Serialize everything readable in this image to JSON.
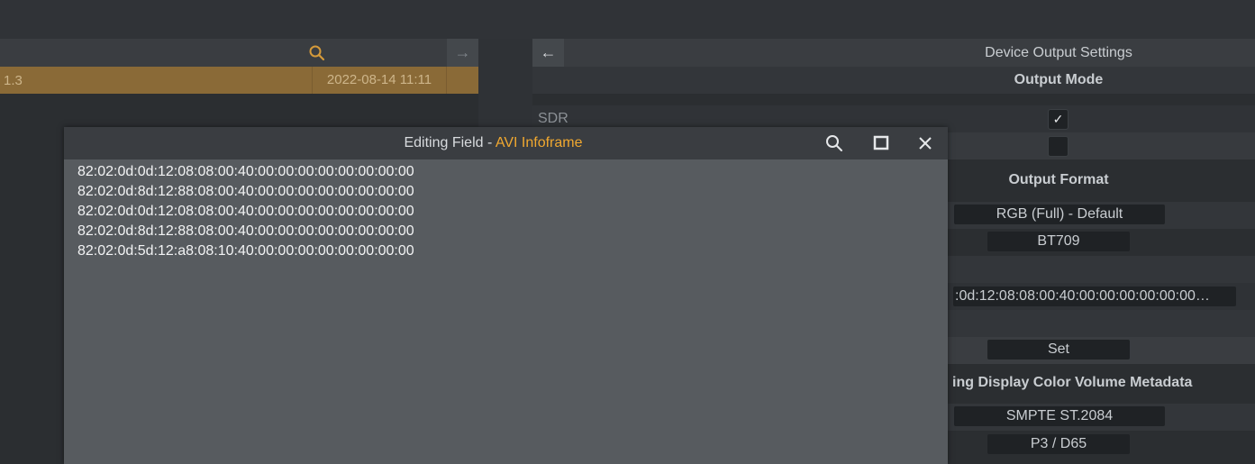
{
  "left_panel": {
    "row": {
      "col1": "1.3",
      "date": "2022-08-14 11:11"
    },
    "arrow_glyph": "→",
    "search_icon": "search-icon"
  },
  "right_panel": {
    "back_glyph": "←",
    "title": "Device Output Settings",
    "output_mode_head": "Output Mode",
    "sdr_label": "SDR",
    "sdr_checked_glyph": "✓",
    "output_format_head": "Output Format",
    "format_value": "RGB (Full) - Default",
    "colorspace_value": "BT709",
    "infoframe_value": ":0d:12:08:08:00:40:00:00:00:00:00:00…",
    "set_label": "Set",
    "mastering_head": "ing Display Color Volume Metadata",
    "eotf_value": "SMPTE ST.2084",
    "primaries_value": "P3 / D65"
  },
  "dialog": {
    "title_prefix": "Editing Field - ",
    "title_accent": "AVI Infoframe",
    "accent_color": "#f0a830",
    "icons": [
      "search-icon",
      "maximize-icon",
      "close-icon"
    ],
    "lines": [
      "82:02:0d:0d:12:08:08:00:40:00:00:00:00:00:00:00:00",
      "82:02:0d:8d:12:88:08:00:40:00:00:00:00:00:00:00:00",
      "82:02:0d:0d:12:08:08:00:40:00:00:00:00:00:00:00:00",
      "82:02:0d:8d:12:88:08:00:40:00:00:00:00:00:00:00:00",
      "82:02:0d:5d:12:a8:08:10:40:00:00:00:00:00:00:00:00"
    ]
  }
}
